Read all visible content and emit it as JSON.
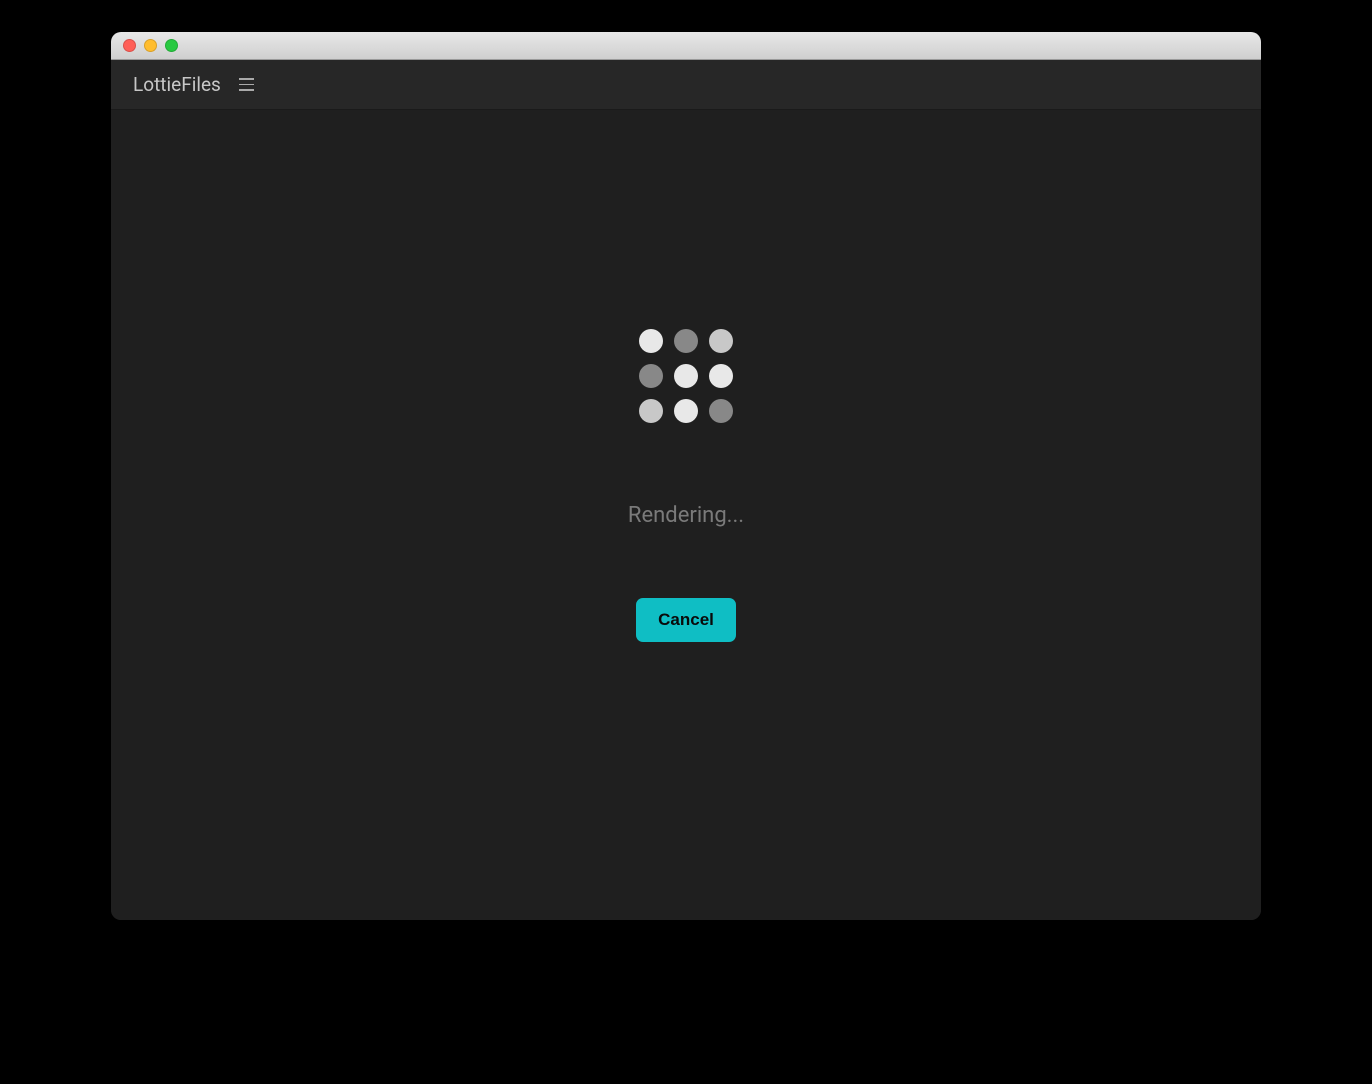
{
  "header": {
    "title": "LottieFiles"
  },
  "main": {
    "status_text": "Rendering...",
    "cancel_label": "Cancel"
  },
  "colors": {
    "accent": "#0fbec4",
    "background": "#1f1f1f",
    "header_bg": "#272727"
  }
}
